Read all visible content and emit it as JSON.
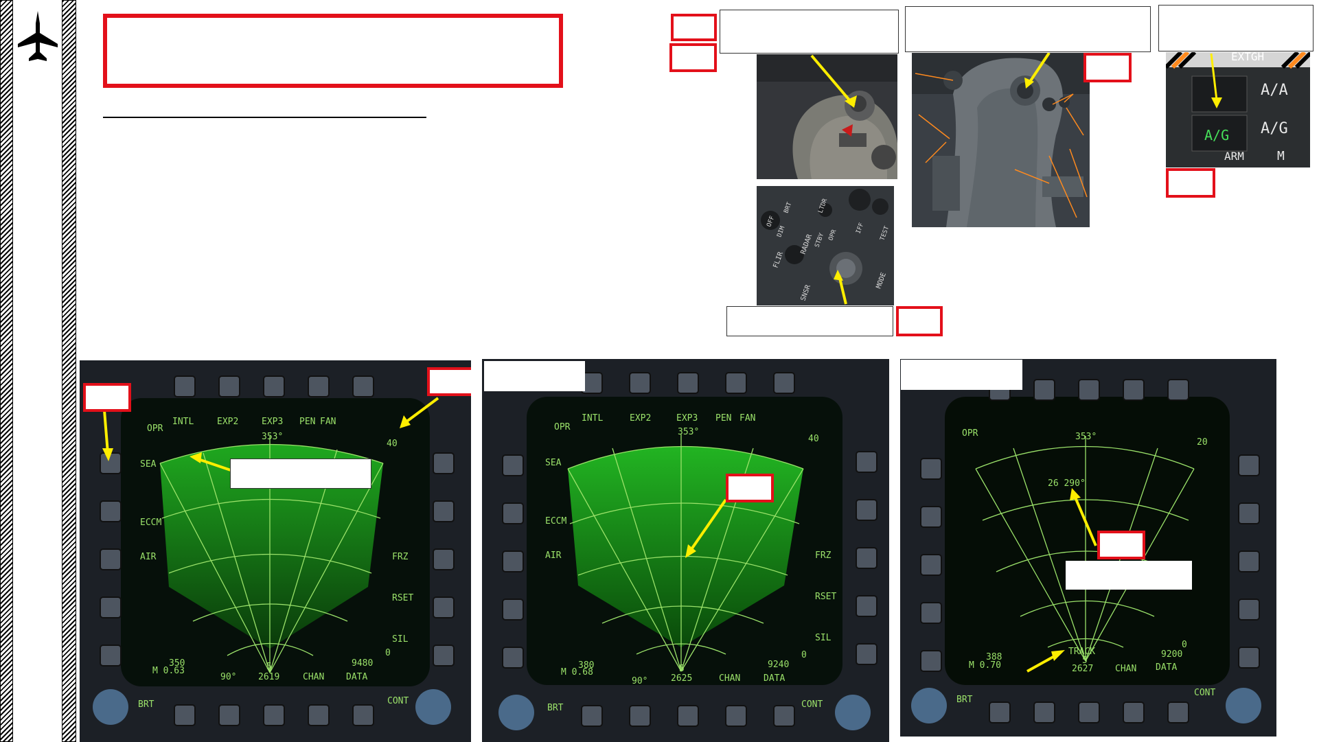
{
  "colors": {
    "accent_red": "#e3101a",
    "radar_green": "#9be26a",
    "arrow_yellow": "#ffee00",
    "display_bg": "#050d06"
  },
  "icons": {
    "logo": "fighter-jet-icon"
  },
  "mfd_common": {
    "modes": [
      "INTL",
      "EXP2",
      "EXP3",
      "PEN",
      "FAN"
    ],
    "opr": "OPR",
    "sea": "SEA",
    "eccm": "ECCM",
    "air": "AIR",
    "frz": "FRZ",
    "rset": "RSET",
    "sil": "SIL",
    "brt": "BRT",
    "cont": "CONT",
    "chan": "CHAN",
    "data": "DATA",
    "ninety": "90°",
    "heading": "353°",
    "zero": "0"
  },
  "mfd1": {
    "range": "40",
    "speed": "350",
    "mach": "M  0.63",
    "bottom_num": "5",
    "alt": "2619",
    "right_num": "9480"
  },
  "mfd2": {
    "range": "40",
    "speed": "380",
    "mach": "M  0.68",
    "bottom_num": "5",
    "alt": "2625",
    "right_num": "9240"
  },
  "mfd3": {
    "range": "20",
    "speed": "388",
    "mach": "M  0.70",
    "track": "TRACK",
    "bottom_num": "5",
    "alt": "2627",
    "right_num": "9200",
    "target": "26 290°"
  },
  "mfd4": {},
  "cockpit": {
    "extgh": "EXTGH",
    "aa_label": "A/A",
    "ag_label": "A/G",
    "arm_label": "ARM",
    "m_label": "M",
    "ag_button": "A/G",
    "panel_labels": [
      "RADAR",
      "FLIR",
      "OFF",
      "DIM",
      "BRT",
      "STBY",
      "OPR",
      "SNSR",
      "MODE",
      "TEST",
      "IFF",
      "LTDR"
    ]
  }
}
